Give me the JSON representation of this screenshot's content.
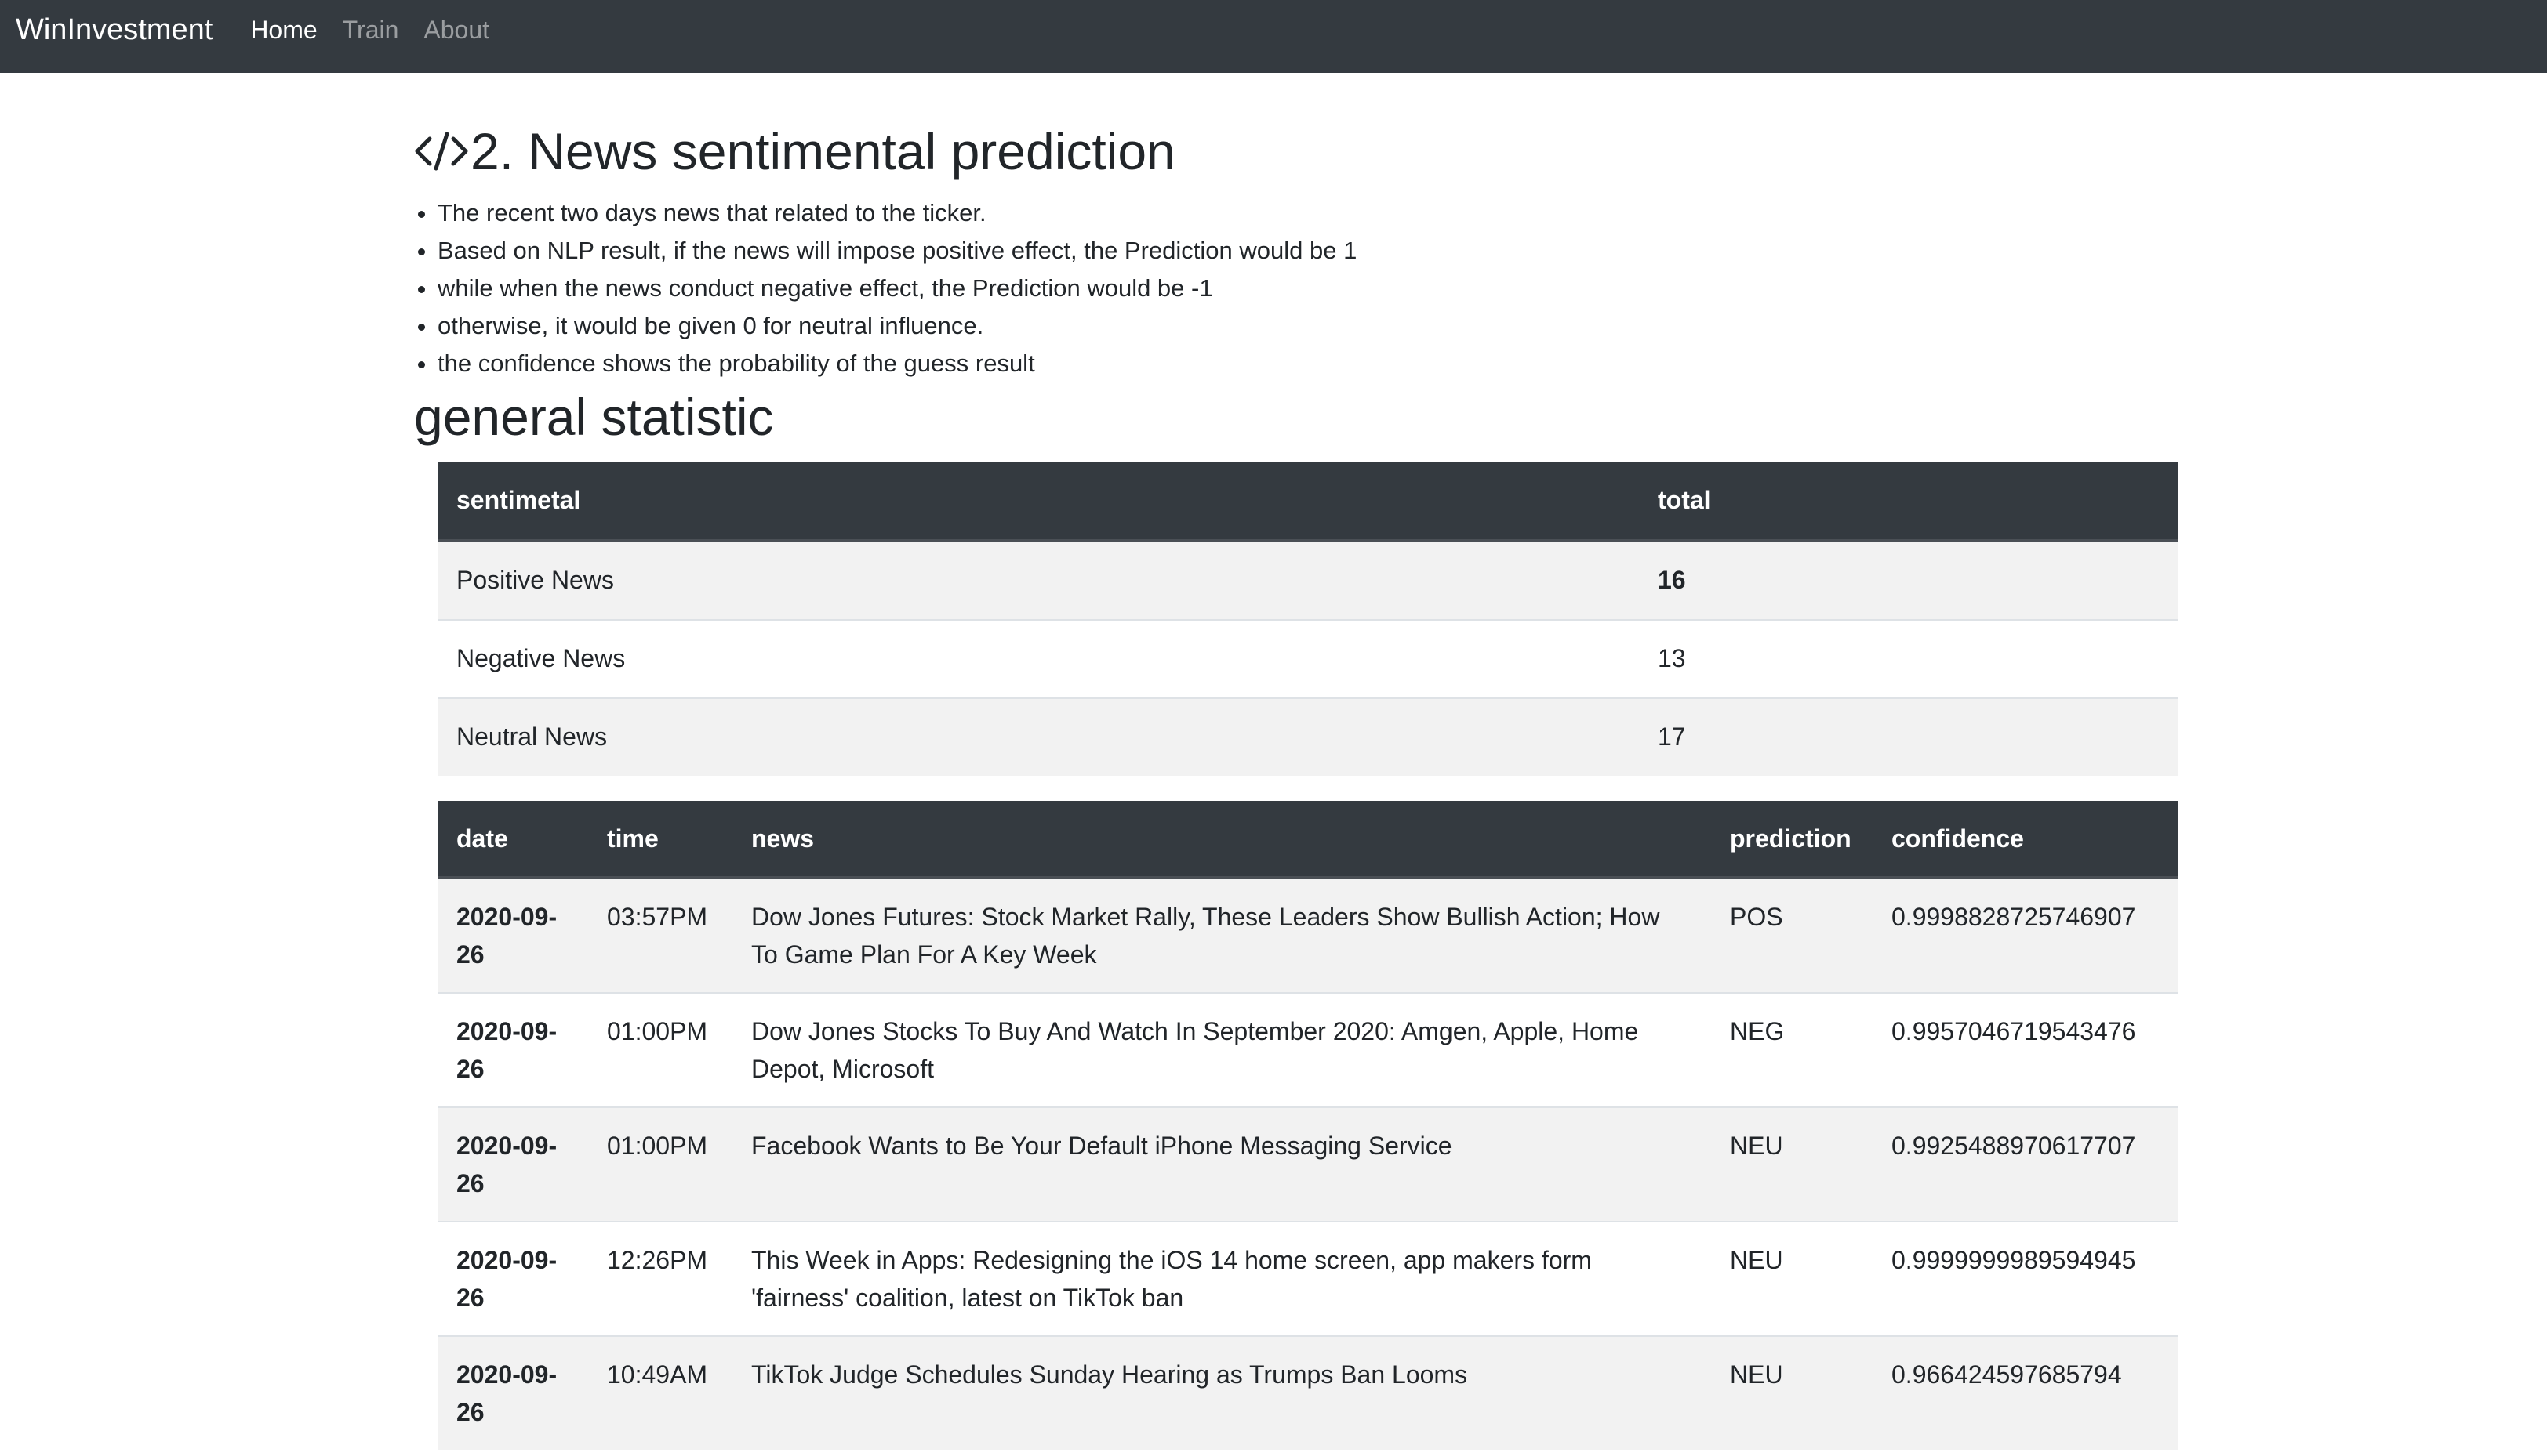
{
  "navbar": {
    "brand": "WinInvestment",
    "links": [
      {
        "label": "Home",
        "active": true
      },
      {
        "label": "Train",
        "active": false
      },
      {
        "label": "About",
        "active": false
      }
    ]
  },
  "section": {
    "icon": "code-icon",
    "title": "2. News sentimental prediction",
    "notes": [
      "The recent two days news that related to the ticker.",
      "Based on NLP result, if the news will impose positive effect, the Prediction would be 1",
      "while when the news conduct negative effect, the Prediction would be -1",
      "otherwise, it would be given 0 for neutral influence.",
      "the confidence shows the probability of the guess result"
    ]
  },
  "stats": {
    "title": "general statistic",
    "headers": [
      "sentimetal",
      "total"
    ],
    "rows": [
      {
        "label": "Positive News",
        "total": "16"
      },
      {
        "label": "Negative News",
        "total": "13"
      },
      {
        "label": "Neutral News",
        "total": "17"
      }
    ]
  },
  "news_table": {
    "headers": [
      "date",
      "time",
      "news",
      "prediction",
      "confidence"
    ],
    "rows": [
      {
        "date": "2020-09-26",
        "time": "03:57PM",
        "news": "Dow Jones Futures: Stock Market Rally, These Leaders Show Bullish Action; How To Game Plan For A Key Week",
        "prediction": "POS",
        "confidence": "0.9998828725746907"
      },
      {
        "date": "2020-09-26",
        "time": "01:00PM",
        "news": "Dow Jones Stocks To Buy And Watch In September 2020: Amgen, Apple, Home Depot, Microsoft",
        "prediction": "NEG",
        "confidence": "0.9957046719543476"
      },
      {
        "date": "2020-09-26",
        "time": "01:00PM",
        "news": "Facebook Wants to Be Your Default iPhone Messaging Service",
        "prediction": "NEU",
        "confidence": "0.9925488970617707"
      },
      {
        "date": "2020-09-26",
        "time": "12:26PM",
        "news": "This Week in Apps: Redesigning the iOS 14 home screen, app makers form 'fairness' coalition, latest on TikTok ban",
        "prediction": "NEU",
        "confidence": "0.9999999989594945"
      },
      {
        "date": "2020-09-26",
        "time": "10:49AM",
        "news": "TikTok Judge Schedules Sunday Hearing as Trumps Ban Looms",
        "prediction": "NEU",
        "confidence": "0.966424597685794"
      }
    ]
  }
}
